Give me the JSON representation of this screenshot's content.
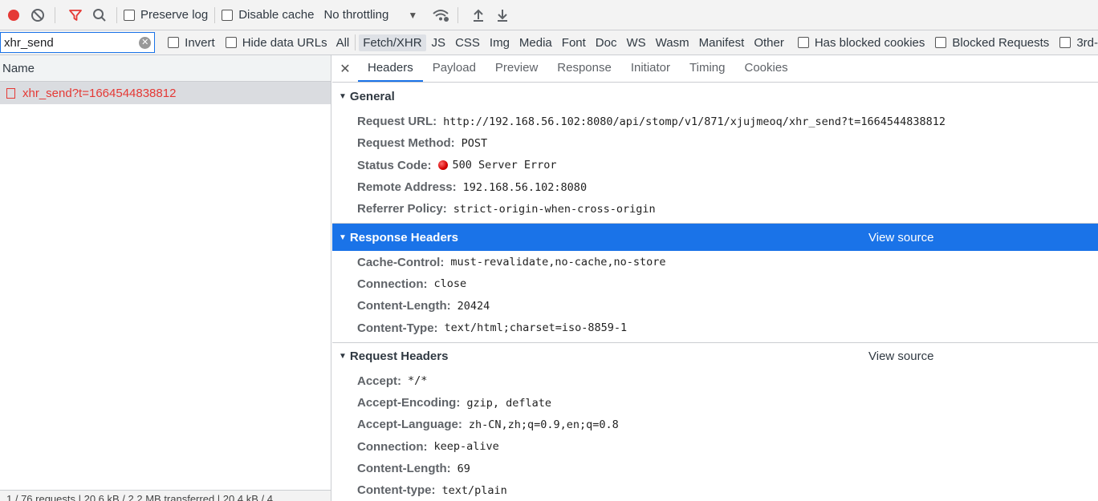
{
  "toolbar": {
    "preserve_log": "Preserve log",
    "disable_cache": "Disable cache",
    "throttling": "No throttling"
  },
  "filter": {
    "value": "xhr_send",
    "invert": "Invert",
    "hide_data_urls": "Hide data URLs",
    "types": [
      "All",
      "Fetch/XHR",
      "JS",
      "CSS",
      "Img",
      "Media",
      "Font",
      "Doc",
      "WS",
      "Wasm",
      "Manifest",
      "Other"
    ],
    "active_type": "Fetch/XHR",
    "has_blocked_cookies": "Has blocked cookies",
    "blocked_requests": "Blocked Requests",
    "third_party": "3rd-"
  },
  "requests": {
    "column_name": "Name",
    "items": [
      {
        "name": "xhr_send?t=1664544838812"
      }
    ],
    "status_text": "1 / 76 requests | 20.6 kB / 2.2 MB transferred | 20.4 kB / 4"
  },
  "tabs": [
    "Headers",
    "Payload",
    "Preview",
    "Response",
    "Initiator",
    "Timing",
    "Cookies"
  ],
  "general": {
    "title": "General",
    "rows": [
      {
        "key": "Request URL:",
        "value": "http://192.168.56.102:8080/api/stomp/v1/871/xjujmeoq/xhr_send?t=1664544838812"
      },
      {
        "key": "Request Method:",
        "value": "POST"
      },
      {
        "key": "Status Code:",
        "value": "500 Server Error"
      },
      {
        "key": "Remote Address:",
        "value": "192.168.56.102:8080"
      },
      {
        "key": "Referrer Policy:",
        "value": "strict-origin-when-cross-origin"
      }
    ]
  },
  "response_headers": {
    "title": "Response Headers",
    "view_source": "View source",
    "rows": [
      {
        "key": "Cache-Control:",
        "value": "must-revalidate,no-cache,no-store"
      },
      {
        "key": "Connection:",
        "value": "close"
      },
      {
        "key": "Content-Length:",
        "value": "20424"
      },
      {
        "key": "Content-Type:",
        "value": "text/html;charset=iso-8859-1"
      }
    ]
  },
  "request_headers": {
    "title": "Request Headers",
    "view_source": "View source",
    "rows": [
      {
        "key": "Accept:",
        "value": "*/*"
      },
      {
        "key": "Accept-Encoding:",
        "value": "gzip, deflate"
      },
      {
        "key": "Accept-Language:",
        "value": "zh-CN,zh;q=0.9,en;q=0.8"
      },
      {
        "key": "Connection:",
        "value": "keep-alive"
      },
      {
        "key": "Content-Length:",
        "value": "69"
      },
      {
        "key": "Content-type:",
        "value": "text/plain"
      }
    ]
  },
  "colors": {
    "accent": "#1a73e8",
    "error": "#e53935",
    "record": "#e53935"
  }
}
